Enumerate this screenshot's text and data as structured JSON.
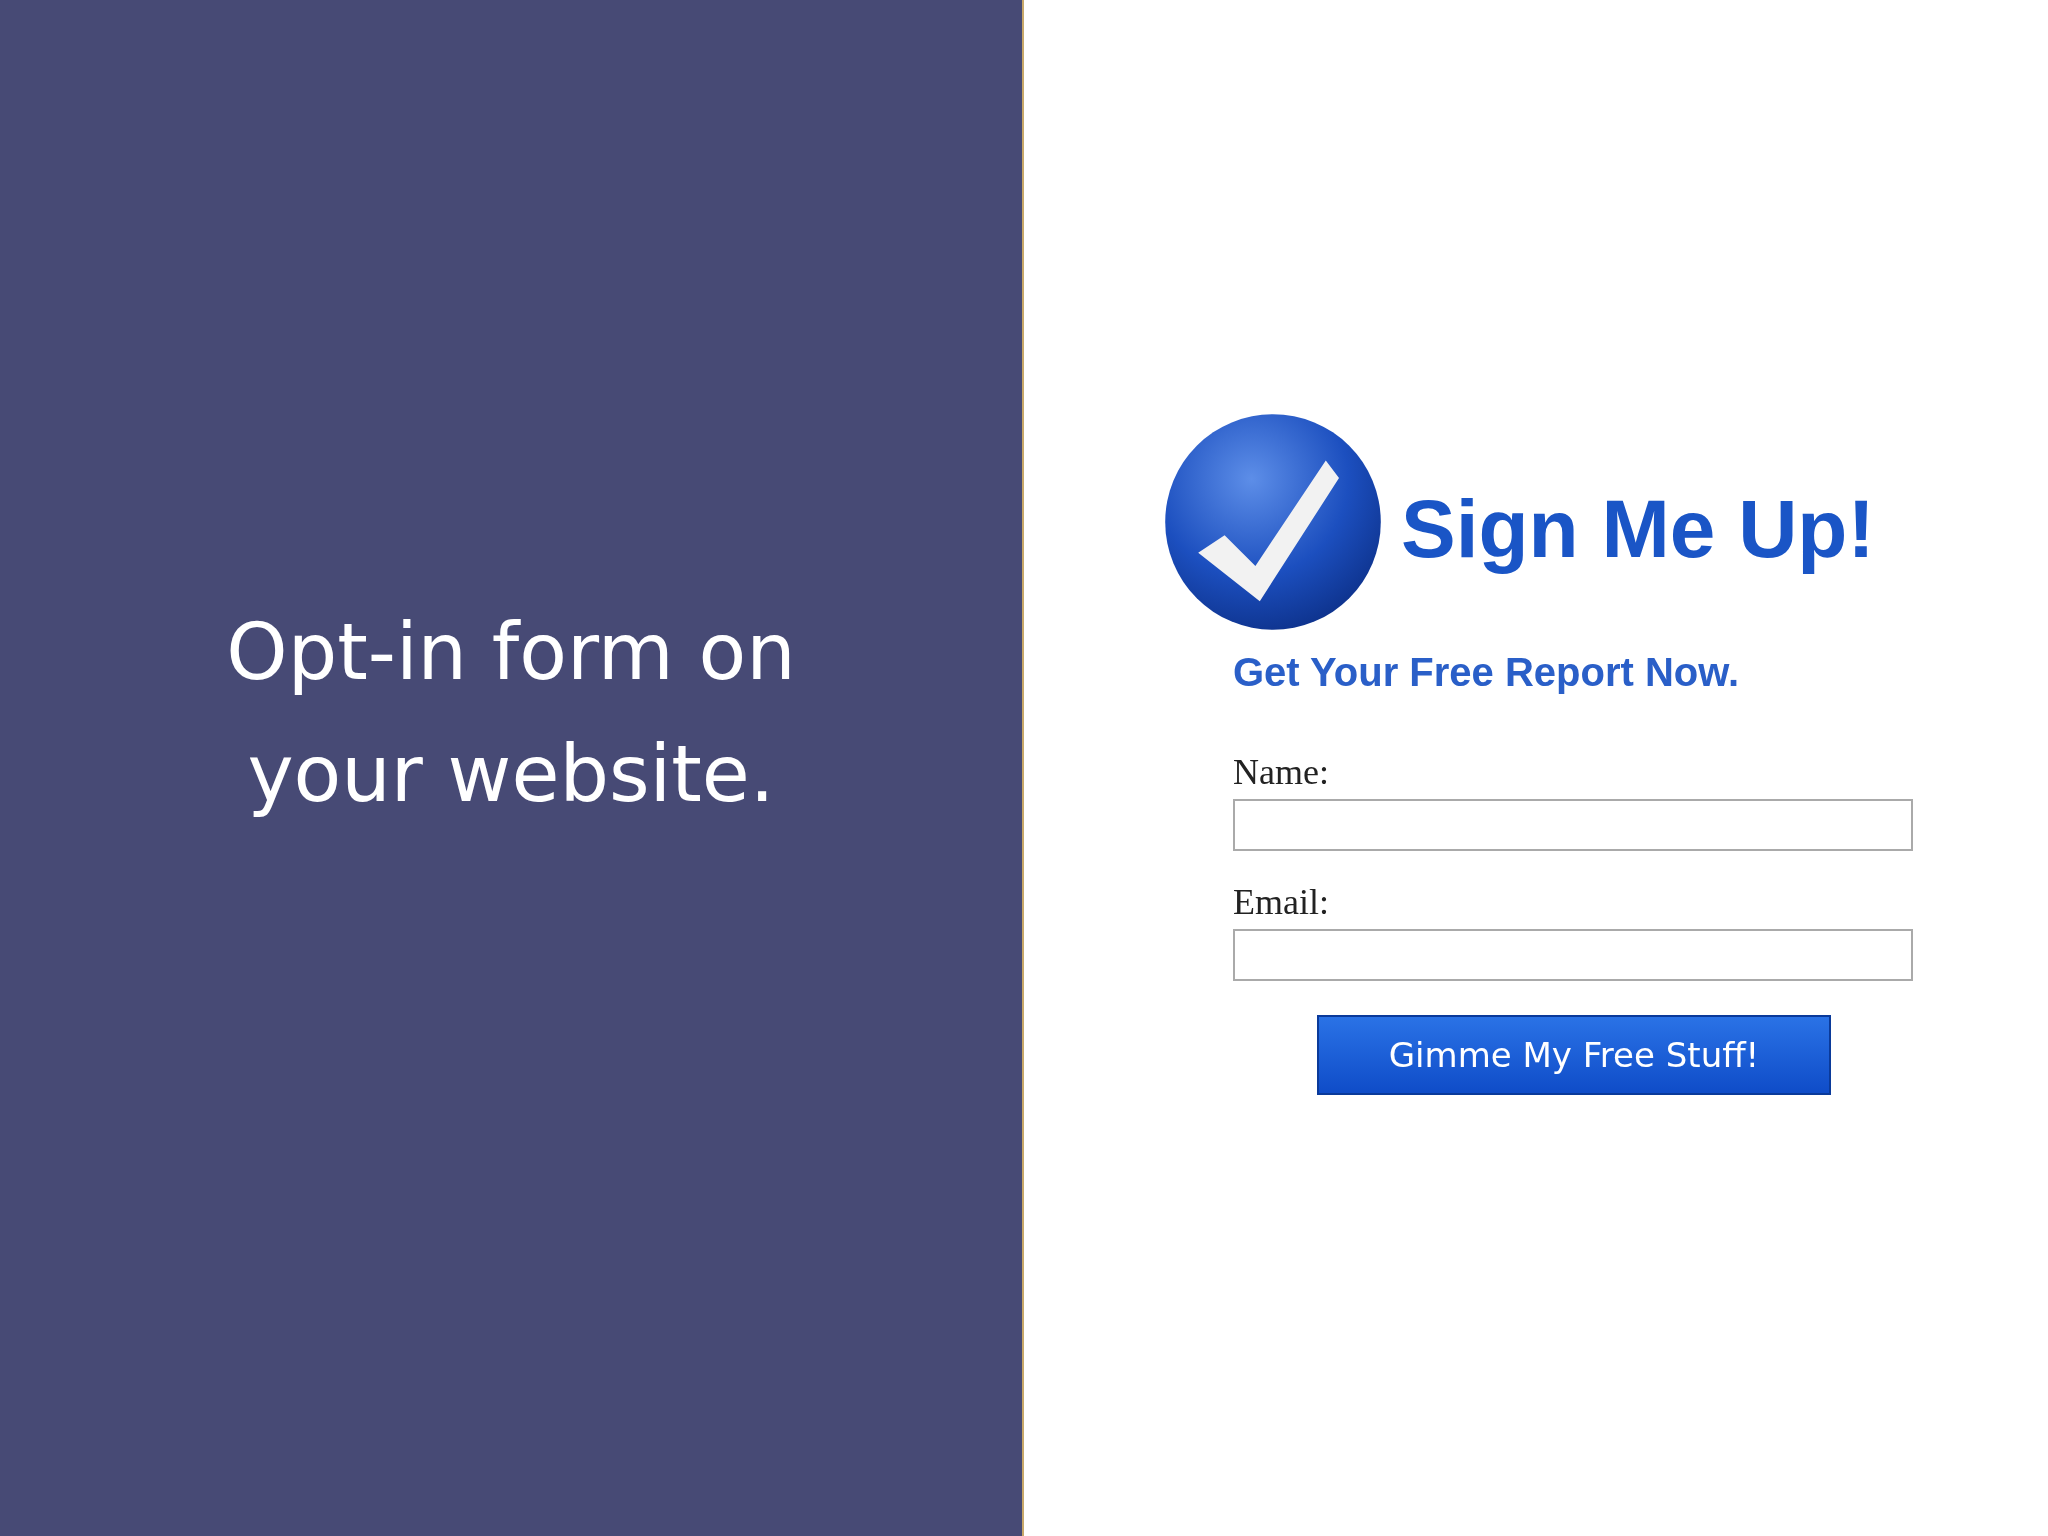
{
  "caption": "Opt-in form on your website.",
  "form": {
    "title": "Sign Me Up!",
    "subtitle": "Get Your Free Report Now.",
    "fields": [
      {
        "label": "Name:"
      },
      {
        "label": "Email:"
      }
    ],
    "button": "Gimme My Free Stuff!"
  }
}
